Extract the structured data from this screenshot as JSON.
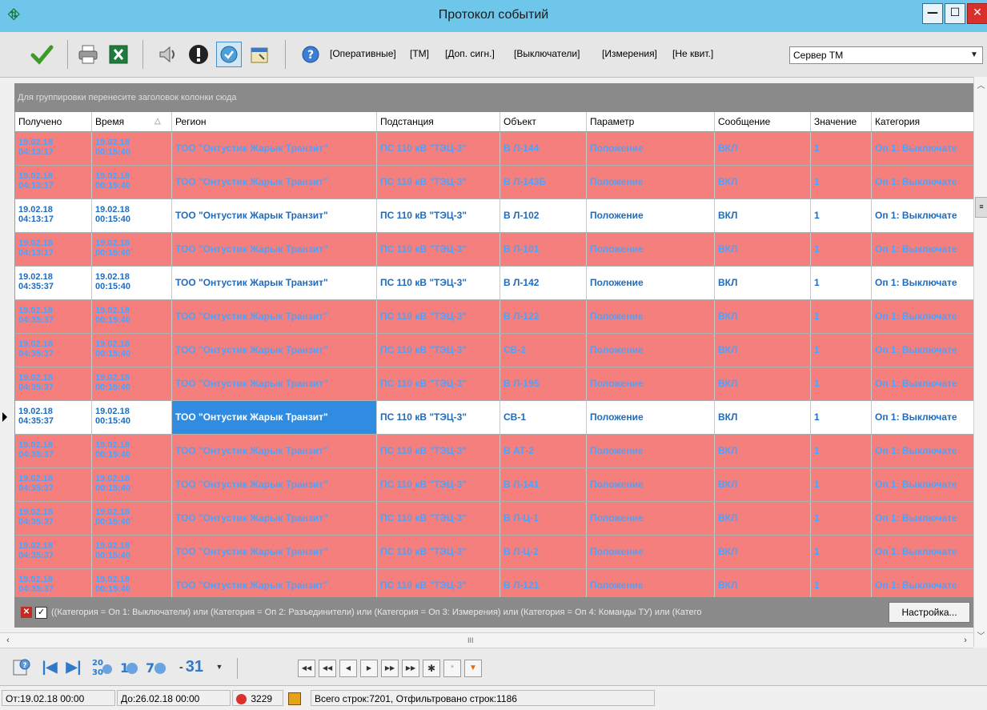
{
  "window": {
    "title": "Протокол событий",
    "min_glyph": "—",
    "max_glyph": "☐",
    "close_glyph": "✕"
  },
  "toolbar": {
    "filters": [
      "[Оперативные]",
      "[ТМ]",
      "[Доп. сигн.]",
      "[Выключатели]",
      "[Измерения]",
      "[Не квит.]"
    ],
    "server": {
      "value": "Сервер ТМ"
    }
  },
  "group_panel": {
    "hint": "Для группировки перенесите заголовок колонки сюда"
  },
  "grid": {
    "columns": [
      "Получено",
      "Время",
      "Регион",
      "Подстанция",
      "Объект",
      "Параметр",
      "Сообщение",
      "Значение",
      "Категория"
    ],
    "sort_indicator": "△",
    "rows": [
      {
        "style": "red",
        "received_date": "19.02.18",
        "received_time": "04:13:17",
        "time_date": "19.02.18",
        "time_time": "00:15:40",
        "region": "ТОО \"Онтустик Жарык Транзит\"",
        "substation": "ПС 110 кВ \"ТЭЦ-3\"",
        "object": "В Л-144",
        "parameter": "Положение",
        "message": "ВКЛ",
        "value": "1",
        "category": "Оп 1: Выключате"
      },
      {
        "style": "red",
        "received_date": "19.02.18",
        "received_time": "04:13:17",
        "time_date": "19.02.18",
        "time_time": "00:15:40",
        "region": "ТОО \"Онтустик Жарык Транзит\"",
        "substation": "ПС 110 кВ \"ТЭЦ-3\"",
        "object": "В Л-143Б",
        "parameter": "Положение",
        "message": "ВКЛ",
        "value": "1",
        "category": "Оп 1: Выключате"
      },
      {
        "style": "white",
        "received_date": "19.02.18",
        "received_time": "04:13:17",
        "time_date": "19.02.18",
        "time_time": "00:15:40",
        "region": "ТОО \"Онтустик Жарык Транзит\"",
        "substation": "ПС 110 кВ \"ТЭЦ-3\"",
        "object": "В Л-102",
        "parameter": "Положение",
        "message": "ВКЛ",
        "value": "1",
        "category": "Оп 1: Выключате"
      },
      {
        "style": "red",
        "received_date": "19.02.18",
        "received_time": "04:13:17",
        "time_date": "19.02.18",
        "time_time": "00:15:40",
        "region": "ТОО \"Онтустик Жарык Транзит\"",
        "substation": "ПС 110 кВ \"ТЭЦ-3\"",
        "object": "В Л-101",
        "parameter": "Положение",
        "message": "ВКЛ",
        "value": "1",
        "category": "Оп 1: Выключате"
      },
      {
        "style": "white",
        "received_date": "19.02.18",
        "received_time": "04:35:37",
        "time_date": "19.02.18",
        "time_time": "00:15:40",
        "region": "ТОО \"Онтустик Жарык Транзит\"",
        "substation": "ПС 110 кВ \"ТЭЦ-3\"",
        "object": "В Л-142",
        "parameter": "Положение",
        "message": "ВКЛ",
        "value": "1",
        "category": "Оп 1: Выключате"
      },
      {
        "style": "red",
        "received_date": "19.02.18",
        "received_time": "04:35:37",
        "time_date": "19.02.18",
        "time_time": "00:15:40",
        "region": "ТОО \"Онтустик Жарык Транзит\"",
        "substation": "ПС 110 кВ \"ТЭЦ-3\"",
        "object": "В Л-122",
        "parameter": "Положение",
        "message": "ВКЛ",
        "value": "1",
        "category": "Оп 1: Выключате"
      },
      {
        "style": "red",
        "received_date": "19.02.18",
        "received_time": "04:35:37",
        "time_date": "19.02.18",
        "time_time": "00:15:40",
        "region": "ТОО \"Онтустик Жарык Транзит\"",
        "substation": "ПС 110 кВ \"ТЭЦ-3\"",
        "object": "СВ-2",
        "parameter": "Положение",
        "message": "ВКЛ",
        "value": "1",
        "category": "Оп 1: Выключате"
      },
      {
        "style": "red",
        "received_date": "19.02.18",
        "received_time": "04:35:37",
        "time_date": "19.02.18",
        "time_time": "00:15:40",
        "region": "ТОО \"Онтустик Жарык Транзит\"",
        "substation": "ПС 110 кВ \"ТЭЦ-3\"",
        "object": "В Л-195",
        "parameter": "Положение",
        "message": "ВКЛ",
        "value": "1",
        "category": "Оп 1: Выключате"
      },
      {
        "style": "white",
        "selected": true,
        "received_date": "19.02.18",
        "received_time": "04:35:37",
        "time_date": "19.02.18",
        "time_time": "00:15:40",
        "region": "ТОО \"Онтустик Жарык Транзит\"",
        "substation": "ПС 110 кВ \"ТЭЦ-3\"",
        "object": "СВ-1",
        "parameter": "Положение",
        "message": "ВКЛ",
        "value": "1",
        "category": "Оп 1: Выключате"
      },
      {
        "style": "red",
        "received_date": "19.02.18",
        "received_time": "04:35:37",
        "time_date": "19.02.18",
        "time_time": "00:15:40",
        "region": "ТОО \"Онтустик Жарык Транзит\"",
        "substation": "ПС 110 кВ \"ТЭЦ-3\"",
        "object": "В АТ-2",
        "parameter": "Положение",
        "message": "ВКЛ",
        "value": "1",
        "category": "Оп 1: Выключате"
      },
      {
        "style": "red",
        "received_date": "19.02.18",
        "received_time": "04:35:37",
        "time_date": "19.02.18",
        "time_time": "00:15:40",
        "region": "ТОО \"Онтустик Жарык Транзит\"",
        "substation": "ПС 110 кВ \"ТЭЦ-3\"",
        "object": "В Л-141",
        "parameter": "Положение",
        "message": "ВКЛ",
        "value": "1",
        "category": "Оп 1: Выключате"
      },
      {
        "style": "red",
        "received_date": "19.02.18",
        "received_time": "04:35:37",
        "time_date": "19.02.18",
        "time_time": "00:15:40",
        "region": "ТОО \"Онтустик Жарык Транзит\"",
        "substation": "ПС 110 кВ \"ТЭЦ-3\"",
        "object": "В Л-Ц-1",
        "parameter": "Положение",
        "message": "ВКЛ",
        "value": "1",
        "category": "Оп 1: Выключате"
      },
      {
        "style": "red",
        "received_date": "19.02.18",
        "received_time": "04:35:37",
        "time_date": "19.02.18",
        "time_time": "00:15:40",
        "region": "ТОО \"Онтустик Жарык Транзит\"",
        "substation": "ПС 110 кВ \"ТЭЦ-3\"",
        "object": "В Л-Ц-2",
        "parameter": "Положение",
        "message": "ВКЛ",
        "value": "1",
        "category": "Оп 1: Выключате"
      },
      {
        "style": "red",
        "received_date": "19.02.18",
        "received_time": "04:35:37",
        "time_date": "19.02.18",
        "time_time": "00:15:40",
        "region": "ТОО \"Онтустик Жарык Транзит\"",
        "substation": "ПС 110 кВ \"ТЭЦ-3\"",
        "object": "В Л-121",
        "parameter": "Положение",
        "message": "ВКЛ",
        "value": "1",
        "category": "Оп 1: Выключате"
      }
    ]
  },
  "filter_bar": {
    "expression": "((Категория = Оп 1: Выключатели) или (Категория = Оп 2: Разъединители) или (Категория = Оп 3: Измерения) или (Категория = Оп 4: Команды ТУ) или (Катего",
    "settings_label": "Настройка..."
  },
  "hscroll": {
    "grip": "III"
  },
  "navbar": {
    "dropdown_label": "31"
  },
  "status": {
    "from": "От:19.02.18 00:00",
    "to": "До:26.02.18 00:00",
    "alarm_count": "3229",
    "totals": "Всего строк:7201, Отфильтровано строк:1186"
  },
  "colors": {
    "row_alarm_bg": "#f47f7d",
    "row_alarm_text": "#4aa3ff",
    "row_normal_text": "#1e6cc0",
    "selection": "#2f8ce0",
    "titlebar": "#6ec6ea"
  }
}
